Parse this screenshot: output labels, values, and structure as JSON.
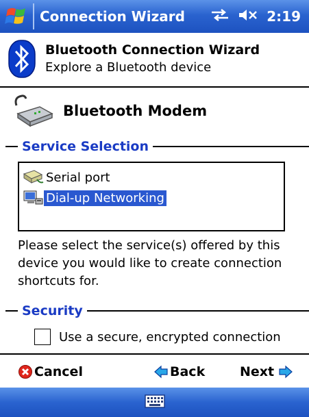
{
  "titlebar": {
    "title": "Connection Wizard",
    "time": "2:19",
    "icons": [
      "windows-flag-icon",
      "connectivity-icon",
      "speaker-muted-icon"
    ]
  },
  "header": {
    "title": "Bluetooth Connection Wizard",
    "subtitle": "Explore a Bluetooth device"
  },
  "device": {
    "name": "Bluetooth Modem",
    "icon": "modem-icon"
  },
  "service_selection": {
    "heading": "Service Selection",
    "items": [
      {
        "label": "Serial port",
        "icon": "serial-port-icon",
        "selected": false
      },
      {
        "label": "Dial-up Networking",
        "icon": "dialup-networking-icon",
        "selected": true
      }
    ],
    "description": "Please select the service(s) offered by this device you would like to create connection shortcuts for."
  },
  "security": {
    "heading": "Security",
    "checkbox_label": "Use a secure, encrypted connection",
    "checked": false
  },
  "nav": {
    "cancel": "Cancel",
    "back": "Back",
    "next": "Next"
  },
  "colors": {
    "titlebar": "#2a63cf",
    "heading": "#1a3bc4",
    "selection": "#2a58d0"
  }
}
